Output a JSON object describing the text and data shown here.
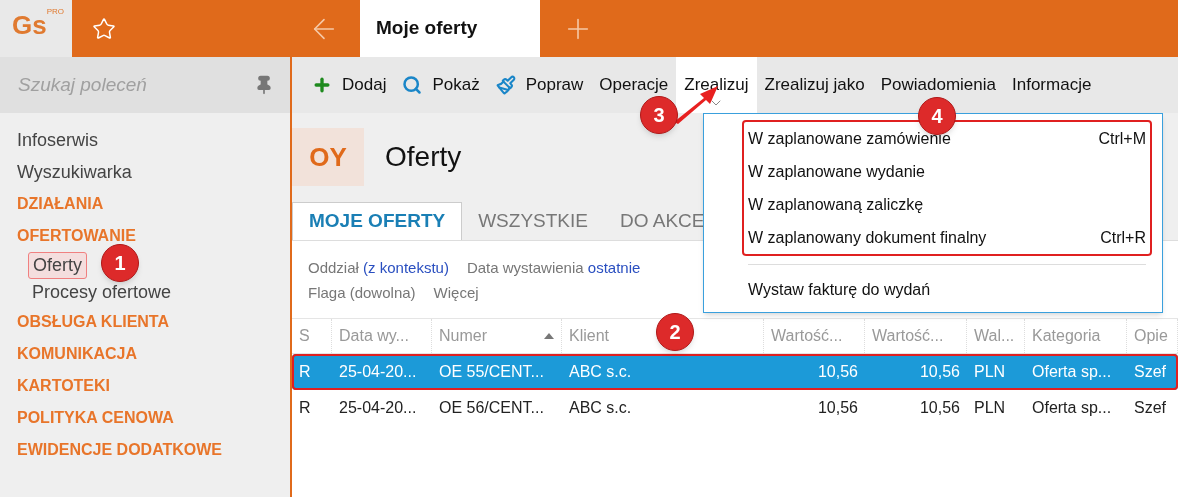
{
  "app": {
    "logo": "Gs",
    "logo_badge": "PRO"
  },
  "tabs": [
    {
      "label": "Moje oferty",
      "selected": true
    }
  ],
  "search": {
    "placeholder": "Szukaj poleceń"
  },
  "sidebar": {
    "items": [
      {
        "label": "Infoserwis",
        "kind": "link"
      },
      {
        "label": "Wyszukiwarka",
        "kind": "link"
      },
      {
        "label": "DZIAŁANIA",
        "kind": "section"
      },
      {
        "label": "OFERTOWANIE",
        "kind": "section",
        "children": [
          {
            "label": "Oferty",
            "highlighted": true
          },
          {
            "label": "Procesy ofertowe",
            "highlighted": false
          }
        ]
      },
      {
        "label": "OBSŁUGA KLIENTA",
        "kind": "section"
      },
      {
        "label": "KOMUNIKACJA",
        "kind": "section"
      },
      {
        "label": "KARTOTEKI",
        "kind": "section"
      },
      {
        "label": "POLITYKA CENOWA",
        "kind": "section"
      },
      {
        "label": "EWIDENCJE DODATKOWE",
        "kind": "section"
      }
    ]
  },
  "toolbar": [
    {
      "label": "Dodaj",
      "kind": "add",
      "expanded": false
    },
    {
      "label": "Pokaż",
      "kind": "show",
      "expanded": false
    },
    {
      "label": "Popraw",
      "kind": "edit",
      "expanded": false
    },
    {
      "label": "Operacje",
      "expanded": false
    },
    {
      "label": "Zrealizuj",
      "expanded": true
    },
    {
      "label": "Zrealizuj jako",
      "expanded": false
    },
    {
      "label": "Powiadomienia",
      "expanded": false
    },
    {
      "label": "Informacje",
      "expanded": false
    }
  ],
  "page": {
    "badge": "OY",
    "title": "Oferty"
  },
  "view_tabs": [
    {
      "label": "MOJE OFERTY",
      "selected": true
    },
    {
      "label": "WSZYSTKIE",
      "selected": false
    },
    {
      "label": "DO AKCE",
      "selected": false
    }
  ],
  "filters": [
    [
      {
        "label": "Oddział",
        "value": "(z kontekstu)"
      },
      {
        "label": "Data wystawienia",
        "value": "ostatnie"
      }
    ],
    [
      {
        "label": "Flaga (dowolna)"
      },
      {
        "label": "Więcej"
      }
    ]
  ],
  "table": {
    "columns": [
      {
        "label": "S",
        "sorted": false
      },
      {
        "label": "Data wy...",
        "sorted": false
      },
      {
        "label": "Numer",
        "sorted": true
      },
      {
        "label": "Klient",
        "sorted": false
      },
      {
        "label": "Wartość...",
        "sorted": false
      },
      {
        "label": "Wartość...",
        "sorted": false
      },
      {
        "label": "Wal...",
        "sorted": false
      },
      {
        "label": "Kategoria",
        "sorted": false
      },
      {
        "label": "Opie",
        "sorted": false
      }
    ],
    "rows": [
      {
        "selected": true,
        "highlighted": true,
        "cells": [
          "R",
          "25-04-20...",
          "OE 55/CENT...",
          "ABC s.c.",
          "10,56",
          "10,56",
          "PLN",
          "Oferta sp...",
          "Szef"
        ]
      },
      {
        "selected": false,
        "highlighted": false,
        "cells": [
          "R",
          "25-04-20...",
          "OE 56/CENT...",
          "ABC s.c.",
          "10,56",
          "10,56",
          "PLN",
          "Oferta sp...",
          "Szef"
        ]
      }
    ]
  },
  "menu": {
    "groups": [
      {
        "highlighted": true,
        "items": [
          {
            "label": "W zaplanowane zamówienie",
            "shortcut": "Ctrl+M"
          },
          {
            "label": "W zaplanowane wydanie"
          },
          {
            "label": "W zaplanowaną zaliczkę"
          },
          {
            "label": "W zaplanowany dokument finalny",
            "shortcut": "Ctrl+R"
          }
        ]
      },
      {
        "highlighted": false,
        "items": [
          {
            "label": "Wystaw fakturę do wydań"
          }
        ]
      }
    ]
  },
  "callouts": [
    {
      "label": "1"
    },
    {
      "label": "2"
    },
    {
      "label": "3"
    },
    {
      "label": "4"
    }
  ]
}
